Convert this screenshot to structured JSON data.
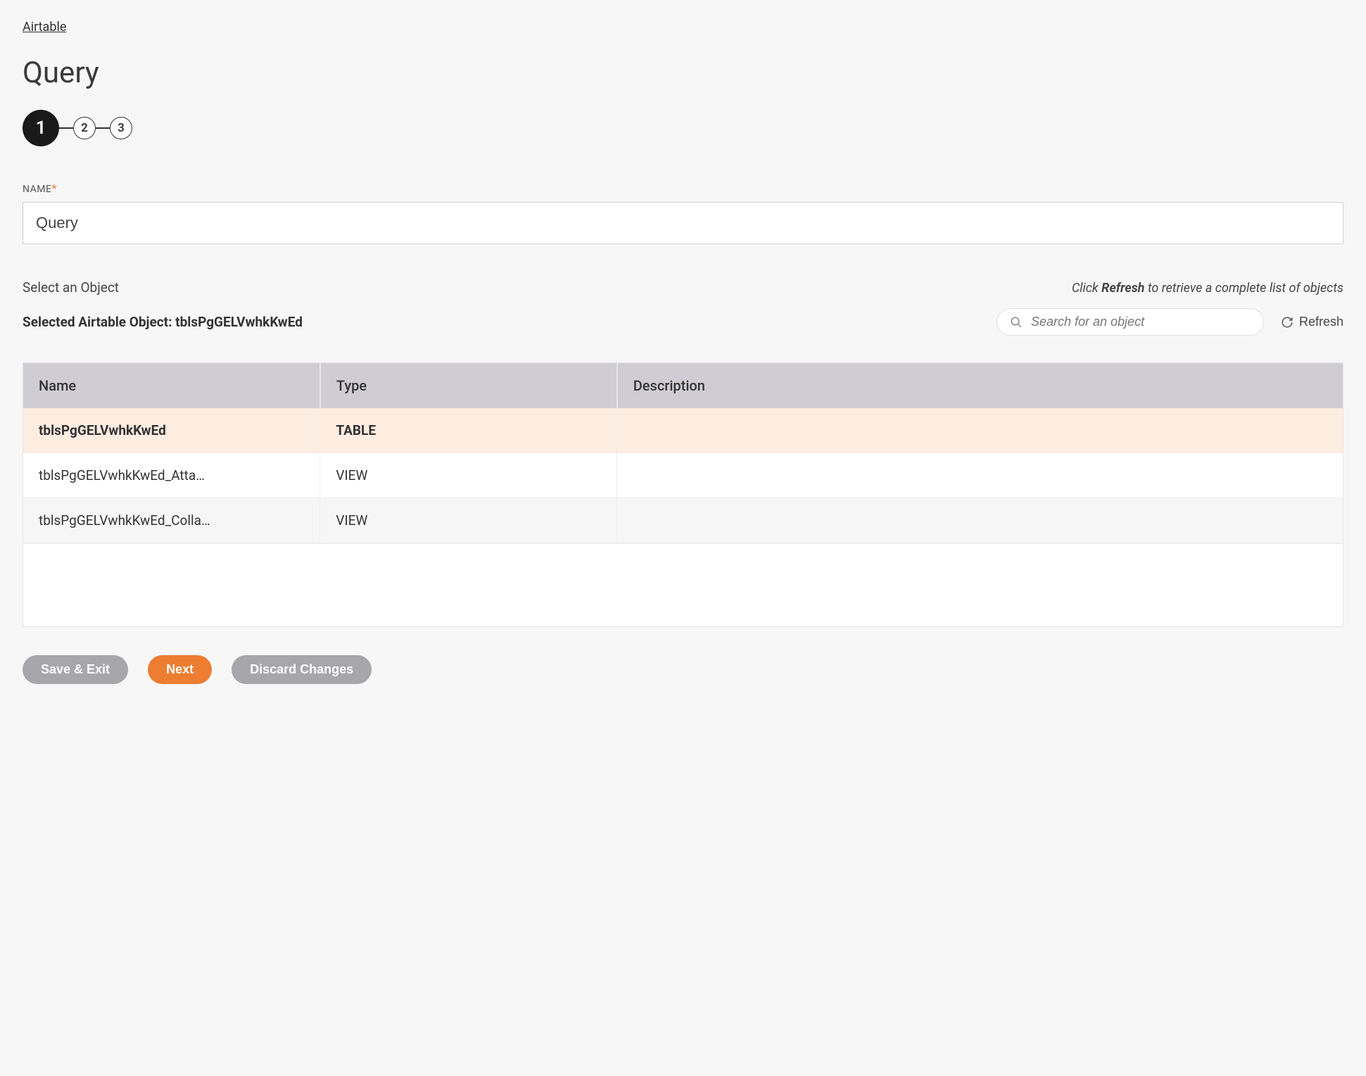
{
  "breadcrumb": "Airtable",
  "page_title": "Query",
  "stepper": {
    "steps": [
      "1",
      "2",
      "3"
    ],
    "active_index": 0
  },
  "name_field": {
    "label": "NAME",
    "required_marker": "*",
    "value": "Query"
  },
  "object_section": {
    "select_label": "Select an Object",
    "refresh_hint_prefix": "Click ",
    "refresh_hint_bold": "Refresh",
    "refresh_hint_suffix": " to retrieve a complete list of objects",
    "selected_label_prefix": "Selected Airtable Object: ",
    "selected_value": "tblsPgGELVwhkKwEd",
    "search_placeholder": "Search for an object",
    "refresh_label": "Refresh"
  },
  "table": {
    "headers": {
      "name": "Name",
      "type": "Type",
      "description": "Description"
    },
    "rows": [
      {
        "name": "tblsPgGELVwhkKwEd",
        "type": "TABLE",
        "description": "",
        "selected": true
      },
      {
        "name": "tblsPgGELVwhkKwEd_Atta…",
        "type": "VIEW",
        "description": "",
        "selected": false
      },
      {
        "name": "tblsPgGELVwhkKwEd_Colla…",
        "type": "VIEW",
        "description": "",
        "selected": false
      }
    ]
  },
  "buttons": {
    "save_exit": "Save & Exit",
    "next": "Next",
    "discard": "Discard Changes"
  }
}
